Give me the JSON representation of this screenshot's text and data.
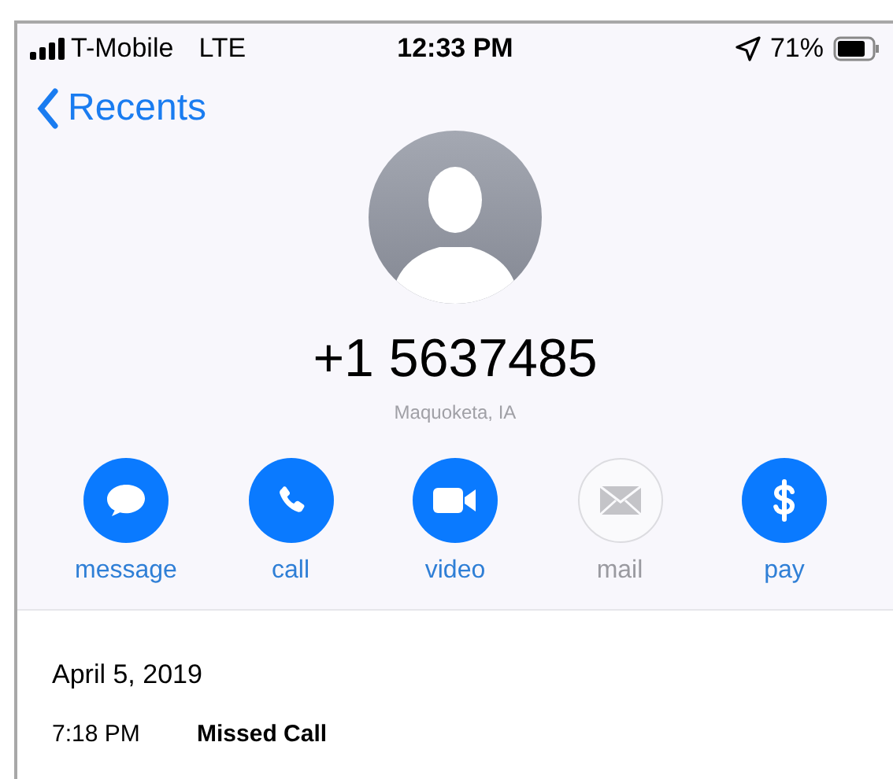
{
  "status_bar": {
    "carrier": "T-Mobile",
    "network": "LTE",
    "time": "12:33 PM",
    "battery": "71%"
  },
  "nav": {
    "back": "Recents"
  },
  "contact": {
    "number": "+1 5637485",
    "location": "Maquoketa, IA"
  },
  "actions": [
    {
      "kind": "message",
      "label": "message",
      "disabled": false
    },
    {
      "kind": "call",
      "label": "call",
      "disabled": false
    },
    {
      "kind": "video",
      "label": "video",
      "disabled": false
    },
    {
      "kind": "mail",
      "label": "mail",
      "disabled": true
    },
    {
      "kind": "pay",
      "label": "pay",
      "disabled": false
    }
  ],
  "history": {
    "date": "April 5, 2019",
    "entries": [
      {
        "time": "7:18 PM",
        "type": "Missed Call"
      }
    ]
  }
}
